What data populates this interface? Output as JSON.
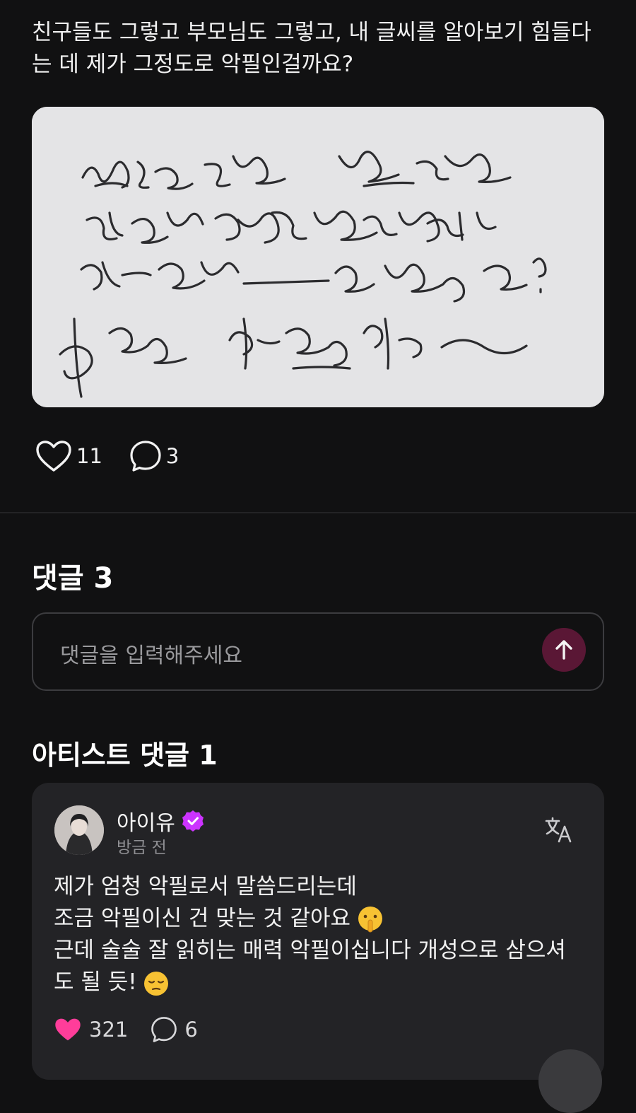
{
  "post": {
    "text_line1": "친구들도 그렇고 부모님도 그렇고, 내 글씨를 알아보기 힘들다",
    "text_line2": "는 데 제가 그정도로 악필인걸까요?",
    "likes": "11",
    "comments": "3"
  },
  "comments_section": {
    "title": "댓글 3",
    "input_placeholder": "댓글을 입력해주세요"
  },
  "artist_comments": {
    "title": "아티스트 댓글 1",
    "items": [
      {
        "author": "아이유",
        "time": "방금 전",
        "line1": "제가 엄청 악필로서 말씀드리는데",
        "line2": "조금 악필이신 건 맞는 것 같아요",
        "line3": "근데 술술 잘 읽히는 매력 악필이십니다 개성으로 삼으셔",
        "line4": "도 될 듯!",
        "likes": "321",
        "replies": "6"
      }
    ]
  },
  "colors": {
    "background": "#111112",
    "accent_pink": "#ff3d9a",
    "verified_purple": "#cc33ff",
    "send_button": "#5a1735"
  },
  "icons": [
    "heart-outline-icon",
    "comment-bubble-icon",
    "arrow-up-icon",
    "verified-badge-icon",
    "translate-icon",
    "heart-filled-icon",
    "shushing-face-emoji",
    "pensive-face-emoji"
  ]
}
